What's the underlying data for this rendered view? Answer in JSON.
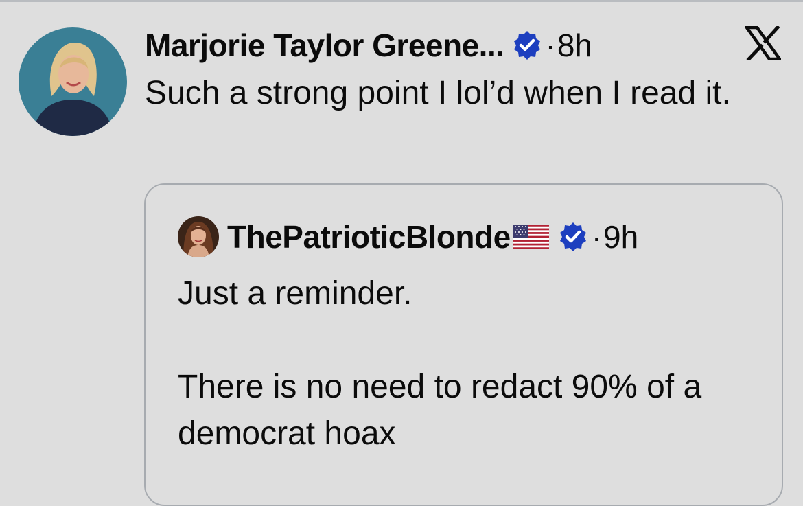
{
  "tweet": {
    "author": {
      "display_name": "Marjorie Taylor Greene...",
      "verified": true,
      "avatar_icon": "profile-photo"
    },
    "separator": "·",
    "time": "8h",
    "platform_icon": "x-logo-icon",
    "text": "Such a strong point I lol’d when I read it."
  },
  "quoted_tweet": {
    "author": {
      "display_name": "ThePatrioticBlonde",
      "flag_icon": "us-flag-icon",
      "verified": true,
      "avatar_icon": "profile-photo"
    },
    "separator": "·",
    "time": "9h",
    "text_lines": [
      "Just a reminder.",
      "There is no need to redact 90% of a democrat hoax"
    ]
  },
  "colors": {
    "background": "#dedede",
    "text": "#0b0b0b",
    "verified_badge": "#1d3fbf",
    "card_border": "#a7abb0"
  }
}
